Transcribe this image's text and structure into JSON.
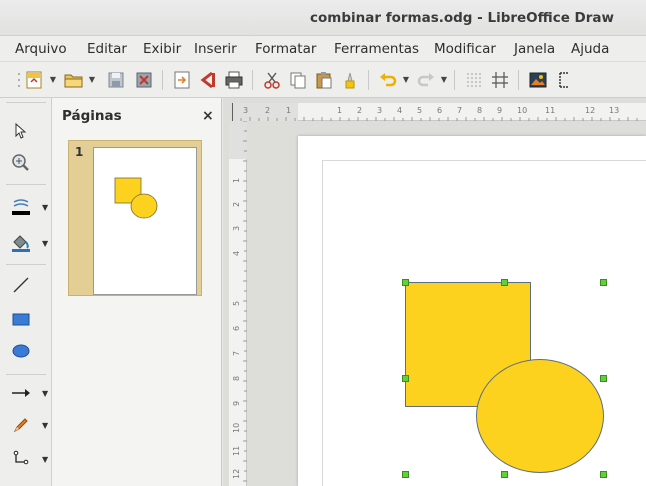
{
  "window": {
    "title": "combinar formas.odg - LibreOffice Draw"
  },
  "menubar": {
    "items": [
      {
        "label": "Arquivo"
      },
      {
        "label": "Editar"
      },
      {
        "label": "Exibir"
      },
      {
        "label": "Inserir"
      },
      {
        "label": "Formatar"
      },
      {
        "label": "Ferramentas"
      },
      {
        "label": "Modificar"
      },
      {
        "label": "Janela"
      },
      {
        "label": "Ajuda"
      }
    ]
  },
  "toolbar": {
    "icons": [
      "new-icon",
      "open-icon",
      "save-icon",
      "export-pdf-icon",
      "export-icon",
      "export-directly-pdf-icon",
      "print-icon",
      "cut-icon",
      "copy-icon",
      "paste-icon",
      "clone-formatting-icon",
      "undo-icon",
      "redo-icon",
      "grid-icon",
      "helplines-icon",
      "image-icon"
    ]
  },
  "pages_panel": {
    "title": "Páginas",
    "close": "×",
    "pages": [
      {
        "number": "1"
      }
    ]
  },
  "ruler": {
    "horizontal": [
      "3",
      "2",
      "1",
      "1",
      "2",
      "3",
      "4",
      "5",
      "6",
      "7",
      "8",
      "9",
      "10",
      "11",
      "12",
      "13"
    ],
    "vertical": [
      "1",
      "2",
      "3",
      "4",
      "5",
      "6",
      "7",
      "8",
      "9",
      "10",
      "11",
      "12"
    ]
  },
  "colors": {
    "shape_fill": "#fdd21f",
    "shape_stroke": "#5d6e80",
    "handle": "#5fd13b"
  }
}
